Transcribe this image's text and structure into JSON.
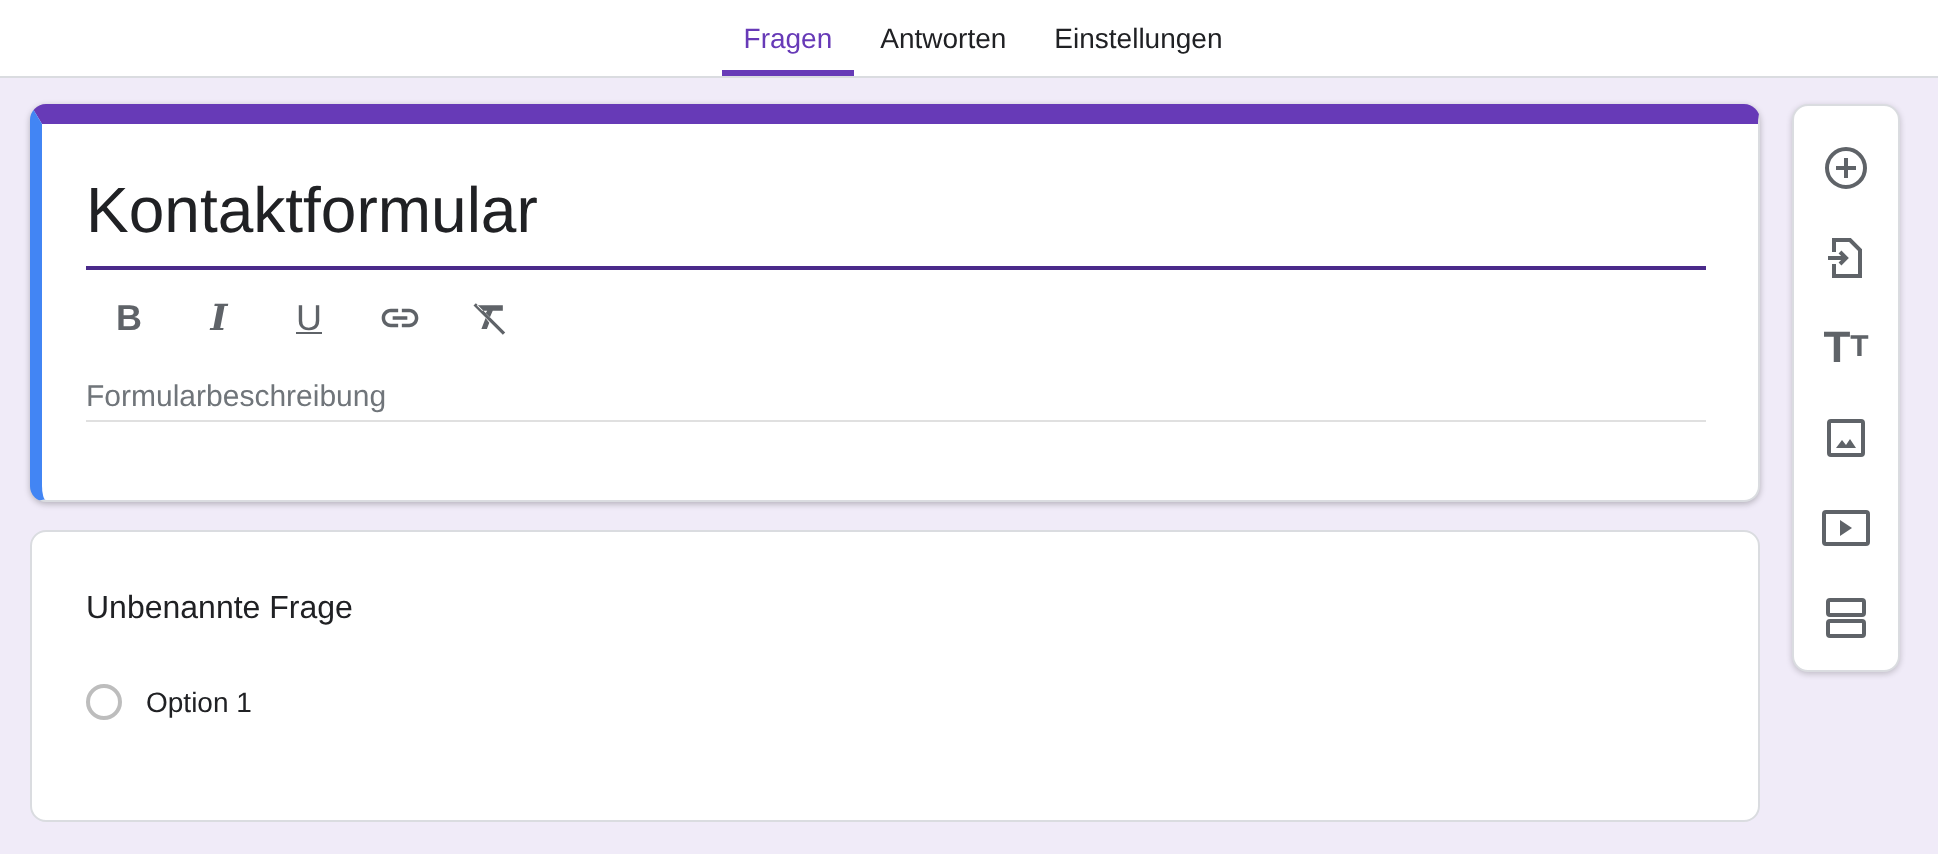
{
  "tabs": [
    {
      "label": "Fragen",
      "selected": true
    },
    {
      "label": "Antworten",
      "selected": false
    },
    {
      "label": "Einstellungen",
      "selected": false
    }
  ],
  "header_card": {
    "title": "Kontaktformular",
    "selected": true,
    "format_tools": [
      {
        "kind": "bold",
        "glyph": "B"
      },
      {
        "kind": "italic",
        "glyph": "I"
      },
      {
        "kind": "underline",
        "glyph": "U"
      },
      {
        "kind": "link"
      },
      {
        "kind": "clear"
      }
    ],
    "description_placeholder": "Formularbeschreibung"
  },
  "question_card": {
    "title": "Unbenannte Frage",
    "options": [
      {
        "label": "Option 1",
        "selected": false
      }
    ]
  },
  "side_tools": [
    {
      "kind": "add"
    },
    {
      "kind": "import"
    },
    {
      "kind": "text",
      "glyph": "T",
      "glyph_small": "T"
    },
    {
      "kind": "image"
    },
    {
      "kind": "video"
    },
    {
      "kind": "section"
    }
  ]
}
